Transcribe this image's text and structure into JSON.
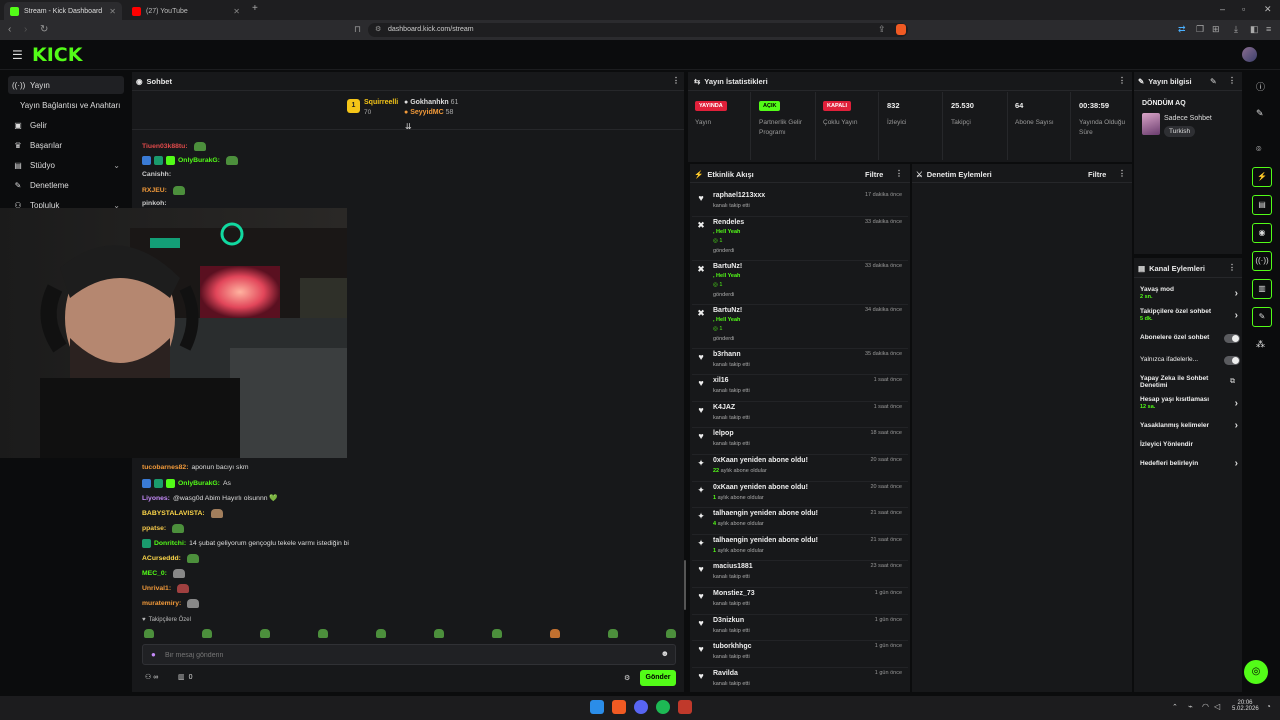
{
  "browser": {
    "tabs": [
      {
        "label": "Stream - Kick Dashboard",
        "color": "#53fc18"
      },
      {
        "label": "(27) YouTube",
        "color": "#ff0000"
      }
    ],
    "url": "dashboard.kick.com/stream"
  },
  "app": {
    "logo": "KICK",
    "accent": "#53fc18"
  },
  "sidebar": {
    "items": [
      {
        "label": "Yayın",
        "icon": "broadcast-icon"
      },
      {
        "label": "Yayın Bağlantısı ve Anahtarı",
        "icon": ""
      },
      {
        "label": "Gelir",
        "icon": "wallet-icon"
      },
      {
        "label": "Başarılar",
        "icon": "trophy-icon"
      },
      {
        "label": "Stüdyo",
        "icon": "studio-icon"
      },
      {
        "label": "Denetleme",
        "icon": "wrench-icon"
      },
      {
        "label": "Topluluk",
        "icon": "community-icon"
      }
    ]
  },
  "chat": {
    "title": "Sohbet",
    "leaderboard": [
      {
        "rank": "1",
        "name": "Squirreelli",
        "count": "70"
      },
      {
        "name": "Gokhanhkn",
        "count": "61"
      },
      {
        "name": "SeyyidMC",
        "count": "58"
      }
    ],
    "top_messages": [
      {
        "user": "Tiuen03k88tu:",
        "text": "",
        "color": "#e04a4a"
      },
      {
        "user": "OnlyBurakG:",
        "text": "",
        "color": "#53fc18"
      },
      {
        "user": "Canishh:",
        "text": "",
        "color": "#cccccc"
      },
      {
        "user": "RXJEU:",
        "text": "",
        "color": "#f29a3a"
      },
      {
        "user": "pinkoh:",
        "text": "",
        "color": "#cccccc"
      }
    ],
    "messages": [
      {
        "user": "tucobarnes82:",
        "text": "aponun bacıyı skm",
        "color": "#f29a3a"
      },
      {
        "user": "OnlyBurakG:",
        "text": "As",
        "color": "#53fc18"
      },
      {
        "user": "Liyones:",
        "text": "@wasg0d Abim Hayırlı olsunnn 💚",
        "color": "#c58af9"
      },
      {
        "user": "BABYSTALAVISTA:",
        "text": "",
        "color": "#ffd84a"
      },
      {
        "user": "ppatse:",
        "text": "",
        "color": "#f6c94a"
      },
      {
        "user": "Donritchi:",
        "text": "14 şubat geliyorum gençoglu tekele varmı istediğin bi",
        "color": "#53fc18"
      },
      {
        "user": "ACurseddd:",
        "text": "",
        "color": "#ffd84a"
      },
      {
        "user": "MEC_0:",
        "text": "",
        "color": "#53fc18"
      },
      {
        "user": "Unrival1:",
        "text": "",
        "color": "#f29a3a"
      },
      {
        "user": "muratemiry:",
        "text": "",
        "color": "#f29a3a"
      }
    ],
    "followers_only": "Takipçilere Özel",
    "input_placeholder": "Bir mesaj gönderin",
    "viewers": "∞",
    "count": "0",
    "send_label": "Gönder"
  },
  "stats": {
    "title": "Yayın İstatistikleri",
    "cols": [
      {
        "badge": "YAYINDA",
        "label": "Yayın",
        "badge_color": "#e0203a"
      },
      {
        "badge": "AÇIK",
        "label": "Partnerlik Gelir Programı",
        "badge_color": "#53fc18"
      },
      {
        "badge": "KAPALI",
        "label": "Çoklu Yayın",
        "badge_color": "#e0203a"
      },
      {
        "value": "832",
        "label": "İzleyici"
      },
      {
        "value": "25.530",
        "label": "Takipçi"
      },
      {
        "value": "64",
        "label": "Abone Sayısı"
      },
      {
        "value": "00:38:59",
        "label": "Yayında Olduğu Süre"
      }
    ]
  },
  "activity": {
    "title": "Etkinlik Akışı",
    "filter": "Filtre",
    "items": [
      {
        "name": "raphael1213xxx",
        "sub": "kanalı takip etti",
        "time": "17 dakika önce",
        "icon": "heart-icon"
      },
      {
        "name": "Rendeles",
        "hy": ", Hell Yeah",
        "kicks": "1",
        "sub": "gönderdi",
        "time": "33 dakika önce",
        "icon": "kicks-icon"
      },
      {
        "name": "BartuNz!",
        "hy": ", Hell Yeah",
        "kicks": "1",
        "sub": "gönderdi",
        "time": "33 dakika önce",
        "icon": "kicks-icon"
      },
      {
        "name": "BartuNz!",
        "hy": ", Hell Yeah",
        "kicks": "1",
        "sub": "gönderdi",
        "time": "34 dakika önce",
        "icon": "kicks-icon"
      },
      {
        "name": "b3rhann",
        "sub": "kanalı takip etti",
        "time": "35 dakika önce",
        "icon": "heart-icon"
      },
      {
        "name": "xil16",
        "sub": "kanalı takip etti",
        "time": "1 saat önce",
        "icon": "heart-icon"
      },
      {
        "name": "K4JAZ",
        "sub": "kanalı takip etti",
        "time": "1 saat önce",
        "icon": "heart-icon"
      },
      {
        "name": "lelpop",
        "sub": "kanalı takip etti",
        "time": "18 saat önce",
        "icon": "heart-icon"
      },
      {
        "name": "0xKaan yeniden abone oldu!",
        "months": "22",
        "sub": "aylık abone oldular",
        "time": "20 saat önce",
        "icon": "sparkle-icon"
      },
      {
        "name": "0xKaan yeniden abone oldu!",
        "months": "1",
        "sub": "aylık abone oldular",
        "time": "20 saat önce",
        "icon": "sparkle-icon"
      },
      {
        "name": "talhaengin yeniden abone oldu!",
        "months": "4",
        "sub": "aylık abone oldular",
        "time": "21 saat önce",
        "icon": "sparkle-icon"
      },
      {
        "name": "talhaengin yeniden abone oldu!",
        "months": "1",
        "sub": "aylık abone oldular",
        "time": "21 saat önce",
        "icon": "sparkle-icon"
      },
      {
        "name": "macius1881",
        "sub": "kanalı takip etti",
        "time": "23 saat önce",
        "icon": "heart-icon"
      },
      {
        "name": "Monstiez_73",
        "sub": "kanalı takip etti",
        "time": "1 gün önce",
        "icon": "heart-icon"
      },
      {
        "name": "D3nizkun",
        "sub": "kanalı takip etti",
        "time": "1 gün önce",
        "icon": "heart-icon"
      },
      {
        "name": "tuborkhhgc",
        "sub": "kanalı takip etti",
        "time": "1 gün önce",
        "icon": "heart-icon"
      },
      {
        "name": "Ravilda",
        "sub": "kanalı takip etti",
        "time": "1 gün önce",
        "icon": "heart-icon"
      }
    ]
  },
  "moderation": {
    "title": "Denetim Eylemleri",
    "filter": "Filtre"
  },
  "stream_info": {
    "title": "Yayın bilgisi",
    "stream_title": "DÖNDÜM AQ",
    "category": "Sadece Sohbet",
    "language": "Turkish"
  },
  "channel_actions": {
    "title": "Kanal Eylemleri",
    "items": [
      {
        "label": "Yavaş mod",
        "sub": "2 sn.",
        "control": "arrow"
      },
      {
        "label": "Takipçilere özel sohbet",
        "sub": "5 dk.",
        "control": "arrow"
      },
      {
        "label": "Abonelere özel sohbet",
        "sub": "",
        "control": "toggle"
      },
      {
        "label": "Yalnızca ifadelerle...",
        "sub": "",
        "control": "toggle"
      },
      {
        "label": "Yapay Zeka ile Sohbet Denetimi",
        "sub": "",
        "control": "external"
      },
      {
        "label": "Hesap yaşı kısıtlaması",
        "sub": "12 sa.",
        "control": "arrow"
      },
      {
        "label": "Yasaklanmış kelimeler",
        "sub": "",
        "control": "arrow"
      },
      {
        "label": "İzleyici Yönlendir",
        "sub": "",
        "control": "none"
      },
      {
        "label": "Hedefleri belirleyin",
        "sub": "",
        "control": "arrow"
      }
    ]
  },
  "taskbar": {
    "time": "20:06",
    "date": "5.02.2026"
  }
}
